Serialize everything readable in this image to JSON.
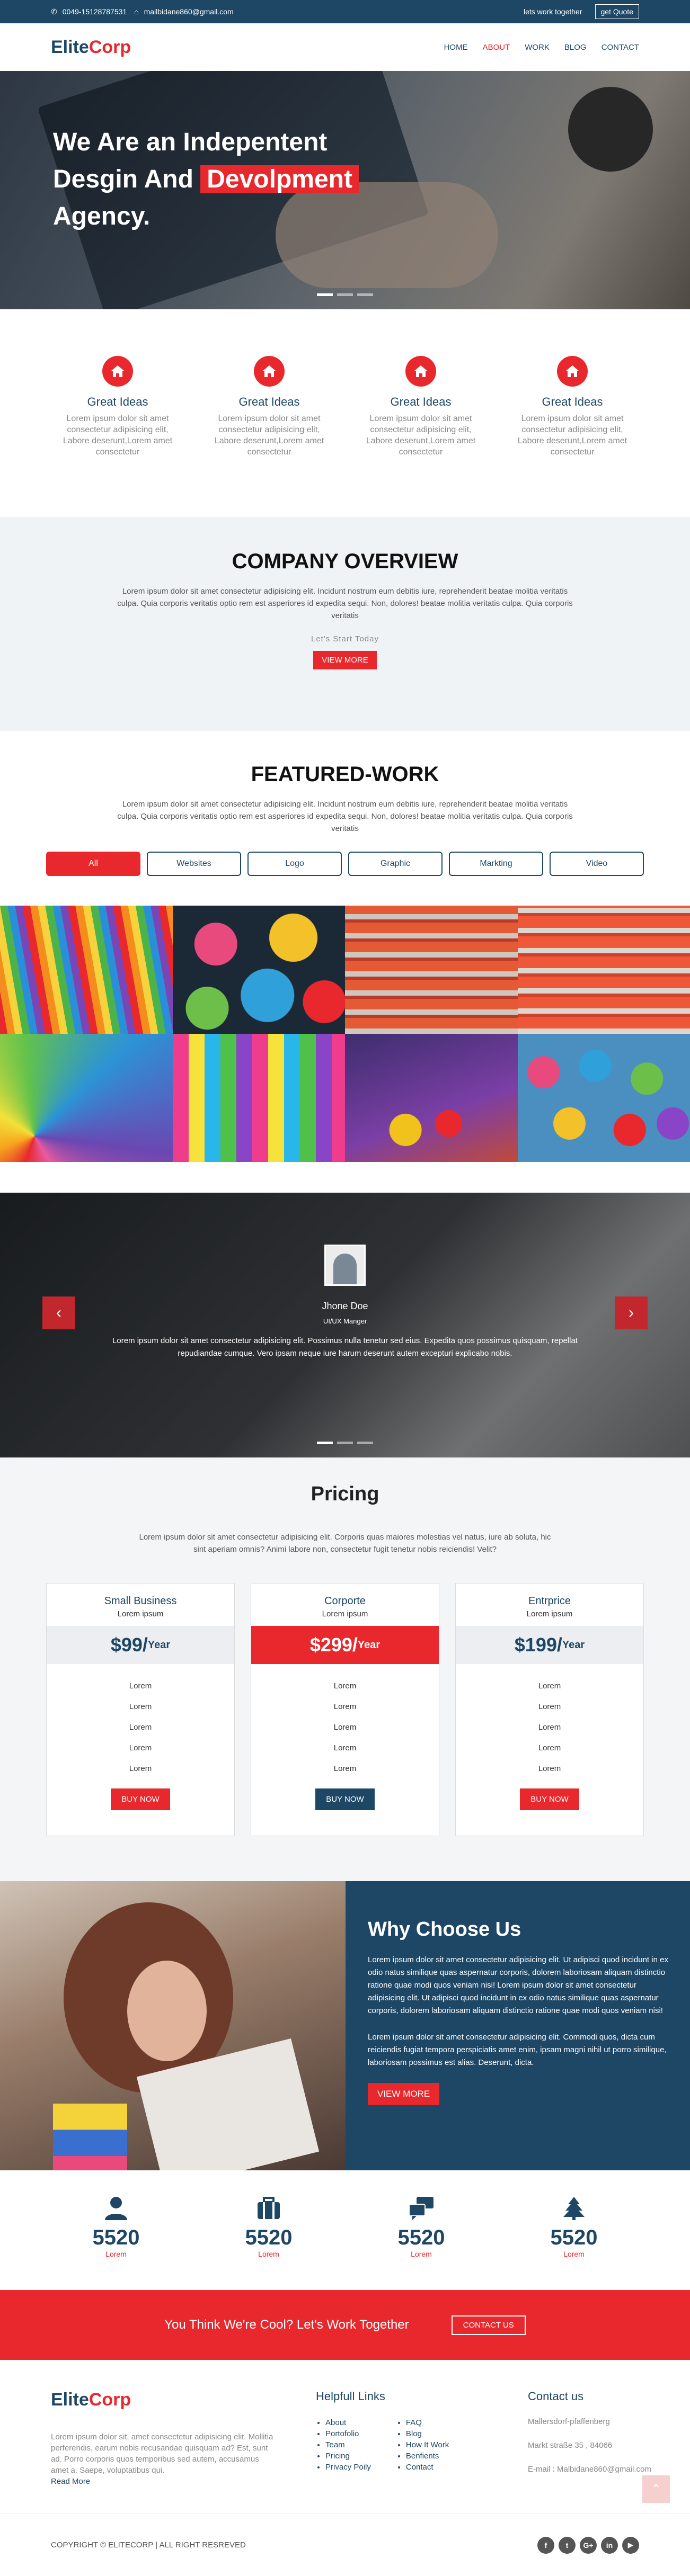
{
  "topbar": {
    "phone": "0049-15128787531",
    "email": "mailbidane860@gmail.com",
    "link": "lets work together",
    "quote_btn": "get Quote"
  },
  "brand": {
    "part1": "Elite",
    "part2": "Corp"
  },
  "nav": [
    "HOME",
    "ABOUT",
    "WORK",
    "BLOG",
    "CONTACT"
  ],
  "hero": {
    "line1": "We Are an Indepentent",
    "line2": "Desgin And",
    "highlight": "Devolpment",
    "line3": "Agency."
  },
  "features": [
    {
      "title": "Great Ideas",
      "text": "Lorem ipsum dolor sit amet consectetur adipisicing elit, Labore deserunt,Lorem amet consectetur"
    },
    {
      "title": "Great Ideas",
      "text": "Lorem ipsum dolor sit amet consectetur adipisicing elit, Labore deserunt,Lorem amet consectetur"
    },
    {
      "title": "Great Ideas",
      "text": "Lorem ipsum dolor sit amet consectetur adipisicing elit, Labore deserunt,Lorem amet consectetur"
    },
    {
      "title": "Great Ideas",
      "text": "Lorem ipsum dolor sit amet consectetur adipisicing elit, Labore deserunt,Lorem amet consectetur"
    }
  ],
  "overview": {
    "title": "COMPANY OVERVIEW",
    "text": "Lorem ipsum dolor sit amet consectetur adipisicing elit. Incidunt nostrum eum debitis iure, reprehenderit beatae molitia veritatis culpa. Quia corporis veritatis optio rem est asperiores id expedita sequi. Non, dolores! beatae molitia veritatis culpa. Quia corporis veritatis",
    "lets": "Let's Start Today",
    "btn": "VIEW MORE"
  },
  "work": {
    "title": "FEATURED-WORK",
    "text": "Lorem ipsum dolor sit amet consectetur adipisicing elit. Incidunt nostrum eum debitis iure, reprehenderit beatae molitia veritatis culpa. Quia corporis veritatis optio rem est asperiores id expedita sequi. Non, dolores! beatae molitia veritatis culpa. Quia corporis veritatis",
    "filters": [
      "All",
      "Websites",
      "Logo",
      "Graphic",
      "Markting",
      "Video"
    ]
  },
  "testimonial": {
    "name": "Jhone Doe",
    "role": "UI/UX Manger",
    "text": "Lorem ipsum dolor sit amet consectetur adipisicing elit. Possimus nulla tenetur sed eius. Expedita quos possimus quisquam, repellat repudiandae cumque. Vero ipsam neque iure harum deserunt autem excepturi explicabo nobis."
  },
  "pricing": {
    "title": "Pricing",
    "text": "Lorem ipsum dolor sit amet consectetur adipisicing elit. Corporis quas maiores molestias vel natus, iure ab soluta, hic sint aperiam omnis? Animi labore non, consectetur fugit tenetur nobis reiciendis! Velit?",
    "plans": [
      {
        "name": "Small Business",
        "sub": "Lorem ipsum",
        "price": "$99/",
        "per": "Year",
        "items": [
          "Lorem",
          "Lorem",
          "Lorem",
          "Lorem",
          "Lorem"
        ],
        "btn": "BUY NOW"
      },
      {
        "name": "Corporte",
        "sub": "Lorem ipsum",
        "price": "$299/",
        "per": "Year",
        "items": [
          "Lorem",
          "Lorem",
          "Lorem",
          "Lorem",
          "Lorem"
        ],
        "btn": "BUY NOW"
      },
      {
        "name": "Entrprice",
        "sub": "Lorem ipsum",
        "price": "$199/",
        "per": "Year",
        "items": [
          "Lorem",
          "Lorem",
          "Lorem",
          "Lorem",
          "Lorem"
        ],
        "btn": "BUY NOW"
      }
    ]
  },
  "why": {
    "title": "Why Choose Us",
    "p1": "Lorem ipsum dolor sit amet consectetur adipisicing elit. Ut adipisci quod incidunt in ex odio natus similique quas aspernatur corporis, dolorem laboriosam aliquam distinctio ratione quae modi quos veniam nisi! Lorem ipsum dolor sit amet consectetur adipisicing elit. Ut adipisci quod incidunt in ex odio natus similique quas aspernatur corporis, dolorem laboriosam aliquam distinctio ratione quae modi quos veniam nisi!",
    "p2": "Lorem ipsum dolor sit amet consectetur adipisicing elit. Commodi quos, dicta cum reiciendis fugiat tempora perspiciatis amet enim, ipsam magni nihil ut porro similique, laboriosam possimus est alias. Deserunt, dicta.",
    "btn": "VIEW MORE"
  },
  "counters": [
    {
      "icon": "user-icon",
      "num": "5520",
      "label": "Lorem"
    },
    {
      "icon": "briefcase-icon",
      "num": "5520",
      "label": "Lorem"
    },
    {
      "icon": "chat-icon",
      "num": "5520",
      "label": "Lorem"
    },
    {
      "icon": "tree-icon",
      "num": "5520",
      "label": "Lorem"
    }
  ],
  "cta": {
    "text": "You Think We're Cool? Let's Work Together",
    "btn": "CONTACT US"
  },
  "footer": {
    "about": "Lorem ipsum dolor sit, amet consectetur adipisicing elit. Mollitia perferendis, earum nobis recusandae quisquam ad? Est, sunt ad. Porro corporis quos temporibus sed autem, accusamus amet a. Saepe, voluptatibus qui.",
    "more": "Read More",
    "links_title": "Helpfull Links",
    "links1": [
      "About",
      "Portofolio",
      "Team",
      "Pricing",
      "Privacy Poily"
    ],
    "links2": [
      "FAQ",
      "Blog",
      "How It Work",
      "Benfients",
      "Contact"
    ],
    "contact_title": "Contact us",
    "address1": "Mallersdorf-pfaffenberg",
    "address2": "Markt straße 35 , 84066",
    "email": "E-mail : Malbidane860@gmail.com"
  },
  "copyright": "COPYRIGHT © ELITECORP | ALL RIGHT RESREVED",
  "social": [
    "facebook-icon",
    "twitter-icon",
    "google-plus-icon",
    "linkedin-icon",
    "youtube-icon"
  ],
  "colors": {
    "navy": "#1e4766",
    "red": "#e8282c"
  }
}
